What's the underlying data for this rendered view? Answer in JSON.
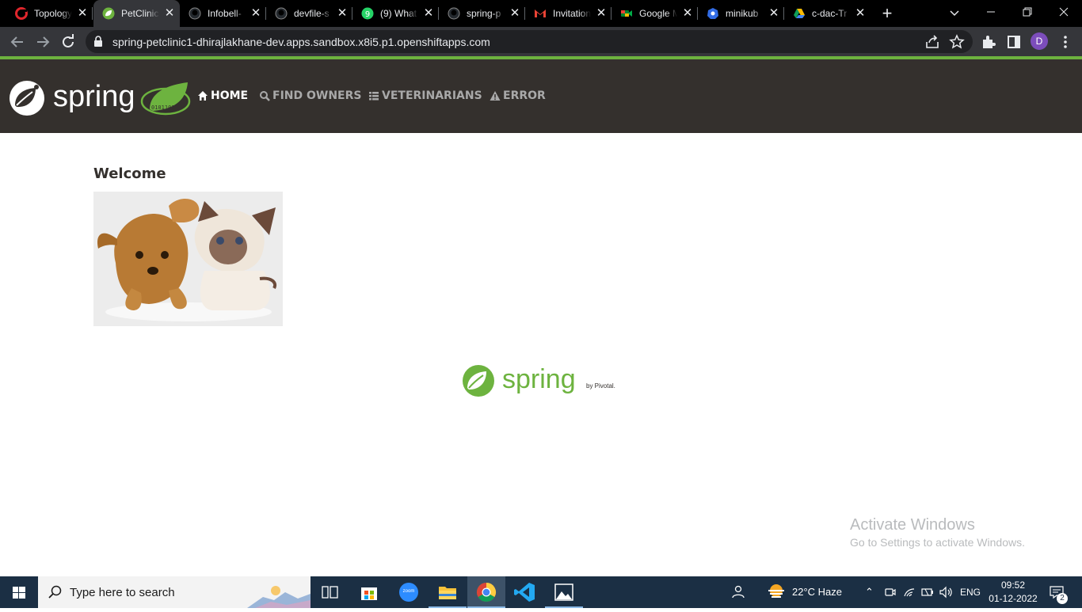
{
  "browser": {
    "tabs": [
      {
        "title": "Topology",
        "icon": "openshift-icon",
        "active": false
      },
      {
        "title": "PetClinic",
        "icon": "spring-leaf-icon",
        "active": true
      },
      {
        "title": "Infobell-",
        "icon": "github-icon",
        "active": false
      },
      {
        "title": "devfile-s",
        "icon": "github-icon",
        "active": false
      },
      {
        "title": "(9) What",
        "icon": "whatsapp-icon",
        "active": false
      },
      {
        "title": "spring-p",
        "icon": "github-icon",
        "active": false
      },
      {
        "title": "Invitation",
        "icon": "gmail-icon",
        "active": false
      },
      {
        "title": "Google M",
        "icon": "google-meet-icon",
        "active": false
      },
      {
        "title": "minikub",
        "icon": "kubernetes-icon",
        "active": false
      },
      {
        "title": "c-dac-Tr",
        "icon": "google-drive-icon",
        "active": false
      }
    ],
    "new_tab_label": "+",
    "url": "spring-petclinic1-dhirajlakhane-dev.apps.sandbox.x8i5.p1.openshiftapps.com",
    "profile_initial": "D"
  },
  "navbar": {
    "brand": "spring",
    "items": [
      {
        "label": "HOME",
        "icon": "home-icon",
        "active": true
      },
      {
        "label": "FIND OWNERS",
        "icon": "search-icon",
        "active": false
      },
      {
        "label": "VETERINARIANS",
        "icon": "list-icon",
        "active": false
      },
      {
        "label": "ERROR",
        "icon": "warning-icon",
        "active": false
      }
    ]
  },
  "main": {
    "heading": "Welcome",
    "image": "pets-image"
  },
  "footer": {
    "brand": "spring",
    "byline": "by Pivotal."
  },
  "watermark": {
    "line1": "Activate Windows",
    "line2": "Go to Settings to activate Windows."
  },
  "taskbar": {
    "search_placeholder": "Type here to search",
    "zoom_label": "zoom",
    "weather": "22°C  Haze",
    "language": "ENG",
    "time": "09:52",
    "date": "01-12-2022",
    "notification_count": "2"
  },
  "colors": {
    "spring_green": "#6db33f",
    "navbar_bg": "#34302d",
    "chrome_dark": "#35363a"
  }
}
